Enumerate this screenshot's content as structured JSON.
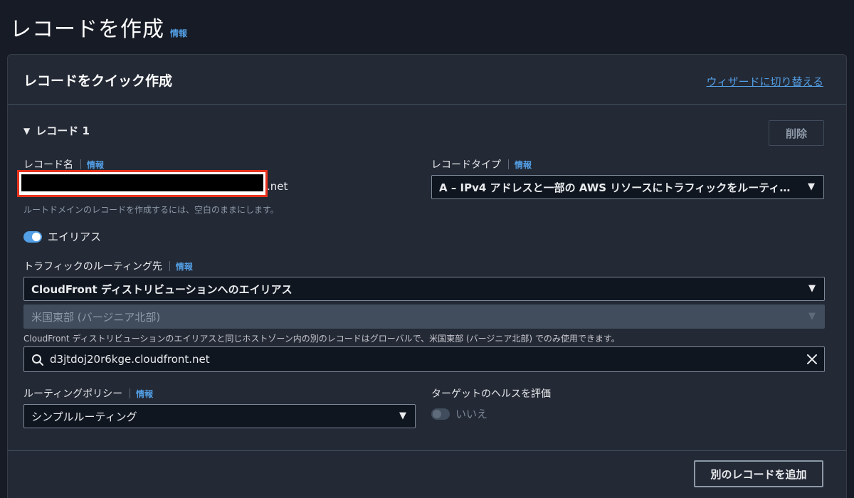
{
  "page": {
    "title": "レコードを作成",
    "info": "情報"
  },
  "panel": {
    "title": "レコードをクイック作成",
    "wizard_link": "ウィザードに切り替える"
  },
  "record": {
    "expand_label": "レコード 1",
    "delete_label": "削除",
    "name_label": "レコード名",
    "name_info": "情報",
    "domain_suffix": ".net",
    "name_hint": "ルートドメインのレコードを作成するには、空白のままにします。",
    "type_label": "レコードタイプ",
    "type_info": "情報",
    "type_value": "A – IPv4 アドレスと一部の AWS リソースにトラフィックをルーティング…",
    "alias_label": "エイリアス",
    "alias_enabled": true,
    "route_label": "トラフィックのルーティング先",
    "route_info": "情報",
    "route_value": "CloudFront ディストリビューションへのエイリアス",
    "region_value": "米国東部 (バージニア北部)",
    "region_hint": "CloudFront ディストリビューションのエイリアスと同じホストゾーン内の別のレコードはグローバルで、米国東部 (バージニア北部) でのみ使用できます。",
    "target_value": "d3jtdoj20r6kge.cloudfront.net",
    "policy_label": "ルーティングポリシー",
    "policy_info": "情報",
    "policy_value": "シンプルルーティング",
    "health_label": "ターゲットのヘルスを評価",
    "health_value": "いいえ",
    "health_enabled": false
  },
  "footer": {
    "add_label": "別のレコードを追加"
  },
  "colors": {
    "background": "#171b25",
    "panel": "#232935",
    "link": "#539fe5",
    "redaction": "#e8321d",
    "input_bg": "#0f1620"
  },
  "icons": {
    "search": "search-icon",
    "clear": "close-icon",
    "caret": "caret-down-icon",
    "dropdown": "triangle-down-icon"
  }
}
